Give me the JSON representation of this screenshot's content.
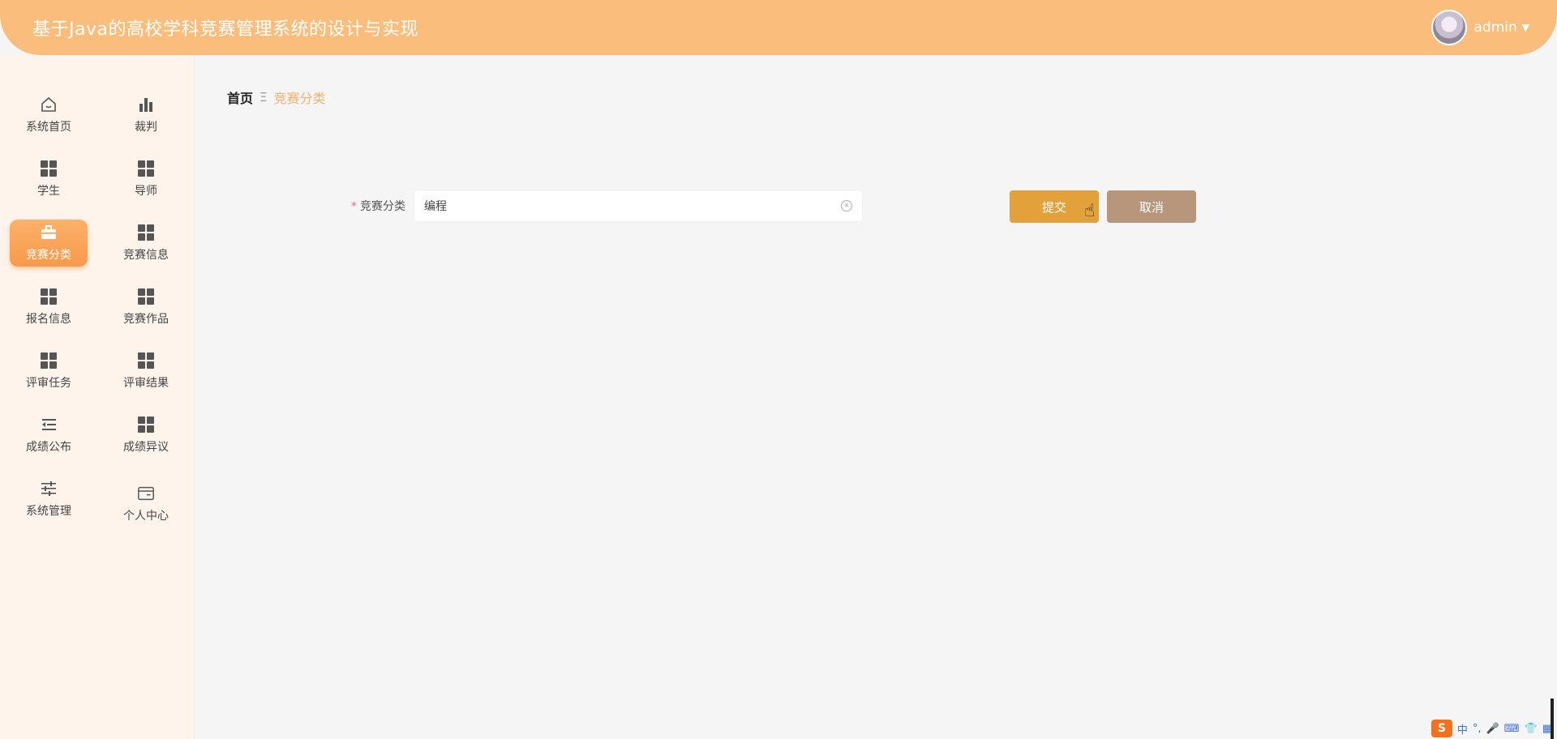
{
  "header": {
    "title": "基于Java的高校学科竞赛管理系统的设计与实现",
    "username": "admin"
  },
  "sidebar": {
    "items": [
      {
        "label": "系统首页",
        "icon": "home-icon"
      },
      {
        "label": "裁判",
        "icon": "bar-chart-icon"
      },
      {
        "label": "学生",
        "icon": "grid-icon"
      },
      {
        "label": "导师",
        "icon": "grid-icon"
      },
      {
        "label": "竞赛分类",
        "icon": "briefcase-icon",
        "active": true
      },
      {
        "label": "竞赛信息",
        "icon": "grid-icon"
      },
      {
        "label": "报名信息",
        "icon": "grid-icon"
      },
      {
        "label": "竞赛作品",
        "icon": "grid-icon"
      },
      {
        "label": "评审任务",
        "icon": "grid-icon"
      },
      {
        "label": "评审结果",
        "icon": "grid-icon"
      },
      {
        "label": "成绩公布",
        "icon": "list-indent-icon"
      },
      {
        "label": "成绩异议",
        "icon": "grid-icon"
      },
      {
        "label": "系统管理",
        "icon": "sliders-icon"
      },
      {
        "label": "个人中心",
        "icon": "wallet-icon"
      }
    ]
  },
  "breadcrumb": {
    "home": "首页",
    "separator": "Ξ",
    "current": "竞赛分类"
  },
  "form": {
    "label": "竞赛分类",
    "required_mark": "*",
    "value": "编程",
    "submit": "提交",
    "cancel": "取消"
  },
  "tray": {
    "ime": "中",
    "ime_logo": "S"
  },
  "colors": {
    "header": "#fbbd7b",
    "accent": "#f8994c",
    "submit": "#e3a13b",
    "cancel": "#b8967b"
  }
}
